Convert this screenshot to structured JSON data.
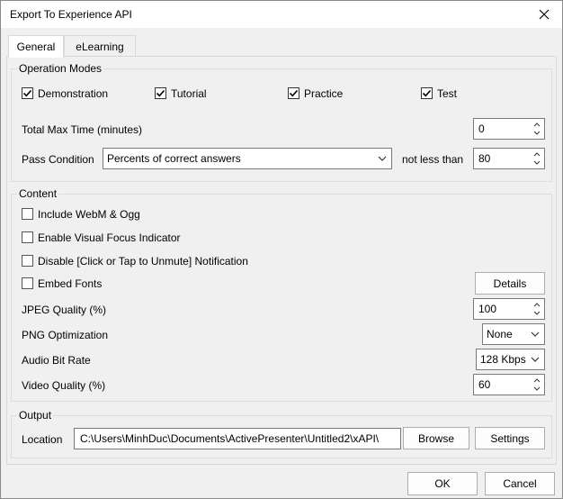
{
  "window": {
    "title": "Export To Experience API"
  },
  "tabs": [
    {
      "label": "General"
    },
    {
      "label": "eLearning"
    }
  ],
  "operation_modes": {
    "title": "Operation Modes",
    "demonstration": {
      "label": "Demonstration",
      "checked": true
    },
    "tutorial": {
      "label": "Tutorial",
      "checked": true
    },
    "practice": {
      "label": "Practice",
      "checked": true
    },
    "test": {
      "label": "Test",
      "checked": true
    },
    "total_max_time": {
      "label": "Total Max Time (minutes)",
      "value": "0"
    },
    "pass_condition": {
      "label": "Pass Condition",
      "selected": "Percents of correct answers",
      "not_less_than_label": "not less than",
      "value": "80"
    }
  },
  "content": {
    "title": "Content",
    "include_webm": {
      "label": "Include WebM & Ogg",
      "checked": false
    },
    "visual_focus": {
      "label": "Enable Visual Focus Indicator",
      "checked": false
    },
    "disable_unmute": {
      "label": "Disable [Click or Tap to Unmute] Notification",
      "checked": false
    },
    "embed_fonts": {
      "label": "Embed Fonts",
      "checked": false
    },
    "details_label": "Details",
    "jpeg_quality": {
      "label": "JPEG Quality (%)",
      "value": "100"
    },
    "png_optimization": {
      "label": "PNG Optimization",
      "selected": "None"
    },
    "audio_bit_rate": {
      "label": "Audio Bit Rate",
      "selected": "128 Kbps"
    },
    "video_quality": {
      "label": "Video Quality (%)",
      "value": "60"
    }
  },
  "output": {
    "title": "Output",
    "location_label": "Location",
    "location_value": "C:\\Users\\MinhDuc\\Documents\\ActivePresenter\\Untitled2\\xAPI\\",
    "browse_label": "Browse",
    "settings_label": "Settings"
  },
  "footer": {
    "ok_label": "OK",
    "cancel_label": "Cancel"
  }
}
